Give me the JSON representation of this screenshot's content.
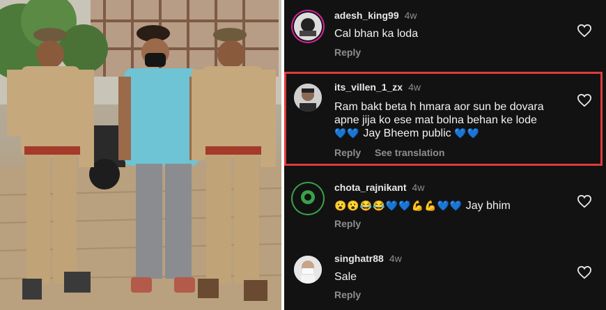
{
  "comments": [
    {
      "username": "adesh_king99",
      "age": "4w",
      "text": "Cal bhan ka loda",
      "reply": "Reply",
      "heart_icon": "heart-outline-icon"
    },
    {
      "username": "its_villen_1_zx",
      "age": "4w",
      "text_lines": [
        "Ram bakt beta h hmara aor sun be dovara",
        "apne jija ko ese mat bolna behan ke lode",
        "Jay Bheem public"
      ],
      "emoji_prefix": "💙💙",
      "emoji_suffix": "💙💙",
      "reply": "Reply",
      "see_translation": "See translation",
      "heart_icon": "heart-outline-icon",
      "highlight_color": "#e03a3a"
    },
    {
      "username": "chota_rajnikant",
      "age": "4w",
      "emojis": "😮😮😂😂💙💙💪💪💙💙",
      "text": "Jay bhim",
      "reply": "Reply",
      "heart_icon": "heart-outline-icon"
    },
    {
      "username": "singhatr88",
      "age": "4w",
      "text": "Sale",
      "reply": "Reply",
      "heart_icon": "heart-outline-icon"
    }
  ],
  "colors": {
    "background": "#121212",
    "muted": "#8e8e8e",
    "highlight": "#e03a3a"
  }
}
